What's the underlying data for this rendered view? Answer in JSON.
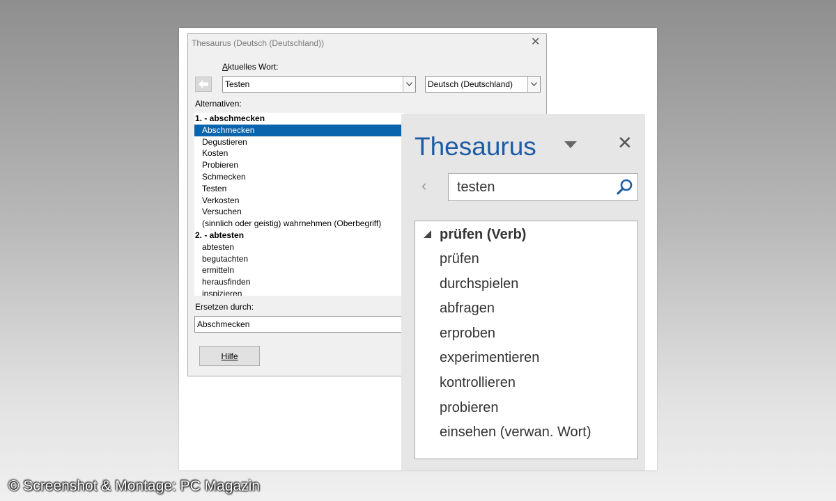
{
  "dialog": {
    "title": "Thesaurus (Deutsch (Deutschland))",
    "current_word_label": "Aktuelles Wort:",
    "current_word_value": "Testen",
    "language_value": "Deutsch (Deutschland)",
    "alternatives_label": "Alternativen:",
    "alternatives": [
      {
        "text": "1. - abschmecken",
        "kind": "head"
      },
      {
        "text": "Abschmecken",
        "kind": "selected"
      },
      {
        "text": "Degustieren",
        "kind": "item"
      },
      {
        "text": "Kosten",
        "kind": "item"
      },
      {
        "text": "Probieren",
        "kind": "item"
      },
      {
        "text": "Schmecken",
        "kind": "item"
      },
      {
        "text": "Testen",
        "kind": "item"
      },
      {
        "text": "Verkosten",
        "kind": "item"
      },
      {
        "text": "Versuchen",
        "kind": "item"
      },
      {
        "text": "(sinnlich oder geistig) wahrnehmen (Oberbegriff)",
        "kind": "item"
      },
      {
        "text": "2. - abtesten",
        "kind": "head"
      },
      {
        "text": "abtesten",
        "kind": "item"
      },
      {
        "text": "begutachten",
        "kind": "item"
      },
      {
        "text": "ermitteln",
        "kind": "item"
      },
      {
        "text": "herausfinden",
        "kind": "item"
      },
      {
        "text": "inspizieren",
        "kind": "item"
      }
    ],
    "replace_label": "Ersetzen durch:",
    "replace_value": "Abschmecken",
    "help_button": "Hilfe"
  },
  "pane": {
    "title": "Thesaurus",
    "search_value": "testen",
    "group_heading": "prüfen (Verb)",
    "results": [
      "prüfen",
      "durchspielen",
      "abfragen",
      "erproben",
      "experimentieren",
      "kontrollieren",
      "probieren",
      "einsehen (verwan. Wort)"
    ]
  },
  "copyright": "© Screenshot & Montage: PC Magazin",
  "colors": {
    "selection": "#0a64ad",
    "pane_title": "#1e5ba5"
  },
  "icons": [
    "back-arrow-icon",
    "dropdown-arrow-icon",
    "close-icon",
    "search-icon",
    "chevron-left-icon",
    "collapse-triangle-icon"
  ]
}
